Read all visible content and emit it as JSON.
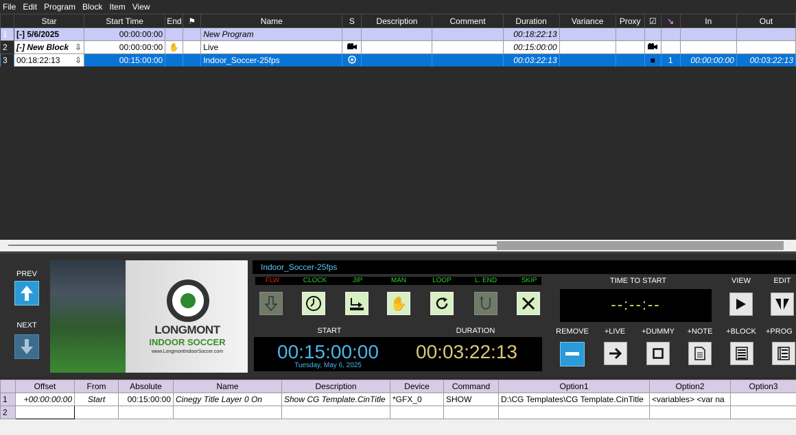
{
  "menu": [
    "File",
    "Edit",
    "Program",
    "Block",
    "Item",
    "View"
  ],
  "playlist": {
    "columns": [
      "",
      "Star",
      "Start Time",
      "End",
      "⚑",
      "Name",
      "S",
      "Description",
      "Comment",
      "Duration",
      "Variance",
      "Proxy",
      "☑",
      "↘",
      "In",
      "Out"
    ],
    "rows": [
      {
        "num": "1",
        "star": "[-] 5/6/2025",
        "start_time": "00:00:00:00",
        "name": "New Program",
        "duration": "00:18:22:13"
      },
      {
        "num": "2",
        "star": "[-] New Block",
        "arrow": "⇩",
        "start_time": "00:00:00:00",
        "end_icon": "✋",
        "name": "Live",
        "s_icon": "camera-icon",
        "duration": "00:15:00:00",
        "check_icon": "camera-icon"
      },
      {
        "num": "3",
        "star": "00:18:22:13",
        "arrow": "⇩",
        "start_time": "00:15:00:00",
        "name": "Indoor_Soccer-25fps",
        "s_icon": "clip-icon",
        "duration": "00:03:22:13",
        "check": "■",
        "idx": "1",
        "in": "00:00:00:00",
        "out": "00:03:22:13"
      }
    ]
  },
  "nav": {
    "prev": "PREV",
    "next": "NEXT"
  },
  "preview": {
    "logo_line1": "LONGMONT",
    "logo_line2": "INDOOR SOCCER",
    "logo_url": "www.LongmontIndoorSoccer.com"
  },
  "clip_title": "Indoor_Soccer-25fps",
  "modes": {
    "flw": "FLW",
    "clock": "CLOCK",
    "jip": "JIP",
    "man": "MAN",
    "loop": "LOOP",
    "lend": "L. END",
    "skip": "SKIP"
  },
  "timing": {
    "start_label": "START",
    "duration_label": "DURATION",
    "start": "00:15:00:00",
    "duration": "00:03:22:13",
    "date": "Tuesday, May 6, 2025"
  },
  "time_to_start": {
    "label": "TIME TO START",
    "value": "--:--:--"
  },
  "actions": {
    "view": "VIEW",
    "edit": "EDIT",
    "remove": "REMOVE",
    "live": "+LIVE",
    "dummy": "+DUMMY",
    "note": "+NOTE",
    "block": "+BLOCK",
    "prog": "+PROG"
  },
  "secondary": {
    "columns": [
      "",
      "Offset",
      "From",
      "Absolute",
      "Name",
      "Description",
      "Device",
      "Command",
      "Option1",
      "Option2",
      "Option3"
    ],
    "rows": [
      {
        "num": "1",
        "offset": "+00:00:00:00",
        "from": "Start",
        "absolute": "00:15:00:00",
        "name": "Cinegy Title Layer 0 On",
        "description": "Show CG Template.CinTitle",
        "device": "*GFX_0",
        "command": "SHOW",
        "option1": "D:\\CG Templates\\CG Template.CinTitle",
        "option2": "<variables> <var na",
        "option3": ""
      },
      {
        "num": "2",
        "offset": "",
        "from": "",
        "absolute": "",
        "name": "",
        "description": "",
        "device": "",
        "command": "",
        "option1": "",
        "option2": "",
        "option3": ""
      }
    ]
  },
  "colors": {
    "selected_row": "#0a74d6",
    "program_row": "#c8cbf5",
    "start_time": "#4ab6ec",
    "duration": "#d9c97a",
    "mode_label": "#2ad12a",
    "flw_label": "#e02020"
  }
}
